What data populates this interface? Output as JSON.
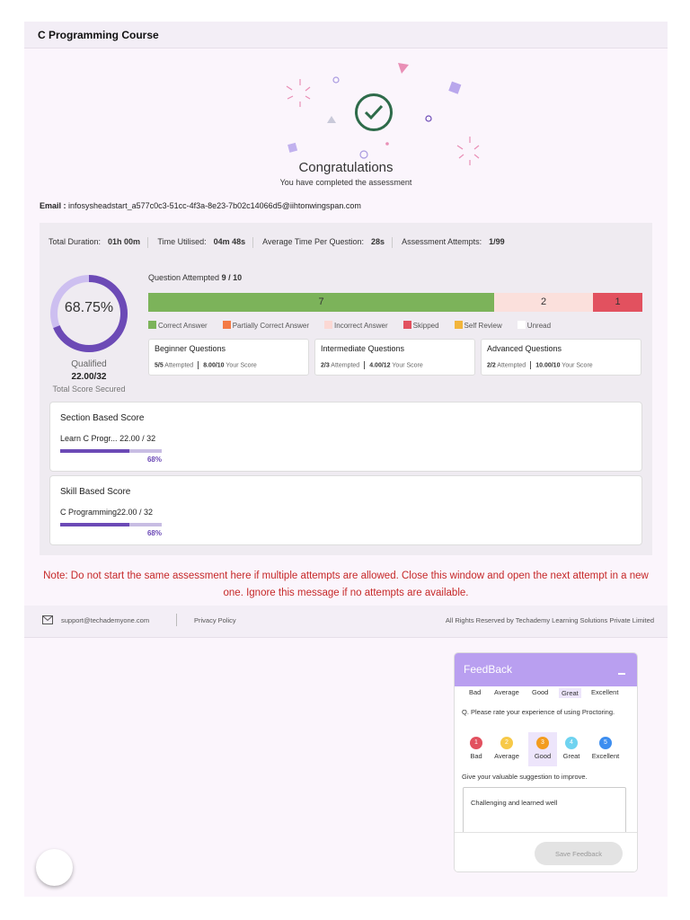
{
  "header": {
    "title": "C Programming Course"
  },
  "result": {
    "heading": "Congratulations",
    "subheading": "You have completed the assessment",
    "email_label": "Email :",
    "email_value": "infosysheadstart_a577c0c3-51cc-4f3a-8e23-7b02c14066d5@iihtonwingspan.com"
  },
  "stats": [
    {
      "label": "Total Duration:",
      "value": "01h 00m"
    },
    {
      "label": "Time Utilised:",
      "value": "04m 48s"
    },
    {
      "label": "Average Time Per Question:",
      "value": "28s"
    },
    {
      "label": "Assessment Attempts:",
      "value": "1/99"
    }
  ],
  "score": {
    "percent_text": "68.75%",
    "percent_fraction": 0.6875,
    "status": "Qualified",
    "secured": "22.00/32",
    "secured_caption": "Total Score Secured",
    "ring_color": "#6c4ab6",
    "ring_track_color": "#cdbff0"
  },
  "questions": {
    "attempted_label": "Question Attempted",
    "attempted_value": "9 / 10",
    "segments": [
      {
        "label": "7",
        "count": 7,
        "color": "#7cb35a"
      },
      {
        "label": "2",
        "count": 2,
        "color": "#fbe0dc"
      },
      {
        "label": "1",
        "count": 1,
        "color": "#e2515f"
      }
    ],
    "legend": [
      {
        "label": "Correct Answer",
        "color": "#7cb35a"
      },
      {
        "label": "Partially Correct Answer",
        "color": "#f47a45"
      },
      {
        "label": "Incorrect Answer",
        "color": "#fbd8d4"
      },
      {
        "label": "Skipped",
        "color": "#e2515f"
      },
      {
        "label": "Self Review",
        "color": "#f2b53c"
      },
      {
        "label": "Unread",
        "color": "#ffffff"
      }
    ]
  },
  "levels": [
    {
      "title": "Beginner Questions",
      "attempted": "5/5",
      "attempted_label": "Attempted",
      "score": "8.00/10",
      "score_label": "Your Score"
    },
    {
      "title": "Intermediate Questions",
      "attempted": "2/3",
      "attempted_label": "Attempted",
      "score": "4.00/12",
      "score_label": "Your Score"
    },
    {
      "title": "Advanced Questions",
      "attempted": "2/2",
      "attempted_label": "Attempted",
      "score": "10.00/10",
      "score_label": "Your Score"
    }
  ],
  "section_score": {
    "title": "Section Based Score",
    "name": "Learn C Progr...",
    "score": "22.00 / 32",
    "percent": "68%",
    "fraction": 0.68
  },
  "skill_score": {
    "title": "Skill Based Score",
    "name": "C Programming",
    "score": "22.00 / 32",
    "percent": "68%",
    "fraction": 0.68
  },
  "note": "Note: Do not start the same assessment here if multiple attempts are allowed. Close this window and open the next attempt in a new one. Ignore this message if no attempts are available.",
  "footer": {
    "support_email": "support@techademyone.com",
    "privacy": "Privacy Policy",
    "rights": "All Rights Reserved by Techademy Learning Solutions Private Limited"
  },
  "feedback": {
    "title": "FeedBack",
    "top_options": [
      "Bad",
      "Average",
      "Good",
      "Great",
      "Excellent"
    ],
    "top_selected": "Great",
    "question": "Q. Please rate your experience of using Proctoring.",
    "options": [
      {
        "num": "1",
        "label": "Bad",
        "color": "#e2515f"
      },
      {
        "num": "2",
        "label": "Average",
        "color": "#f7c948"
      },
      {
        "num": "3",
        "label": "Good",
        "color": "#f39c1f"
      },
      {
        "num": "4",
        "label": "Great",
        "color": "#6fd3f0"
      },
      {
        "num": "5",
        "label": "Excellent",
        "color": "#3d8ef0"
      }
    ],
    "selected": "Good",
    "suggestion_label": "Give your valuable suggestion to improve.",
    "suggestion_value": "Challenging and learned well",
    "save_label": "Save Feedback"
  }
}
